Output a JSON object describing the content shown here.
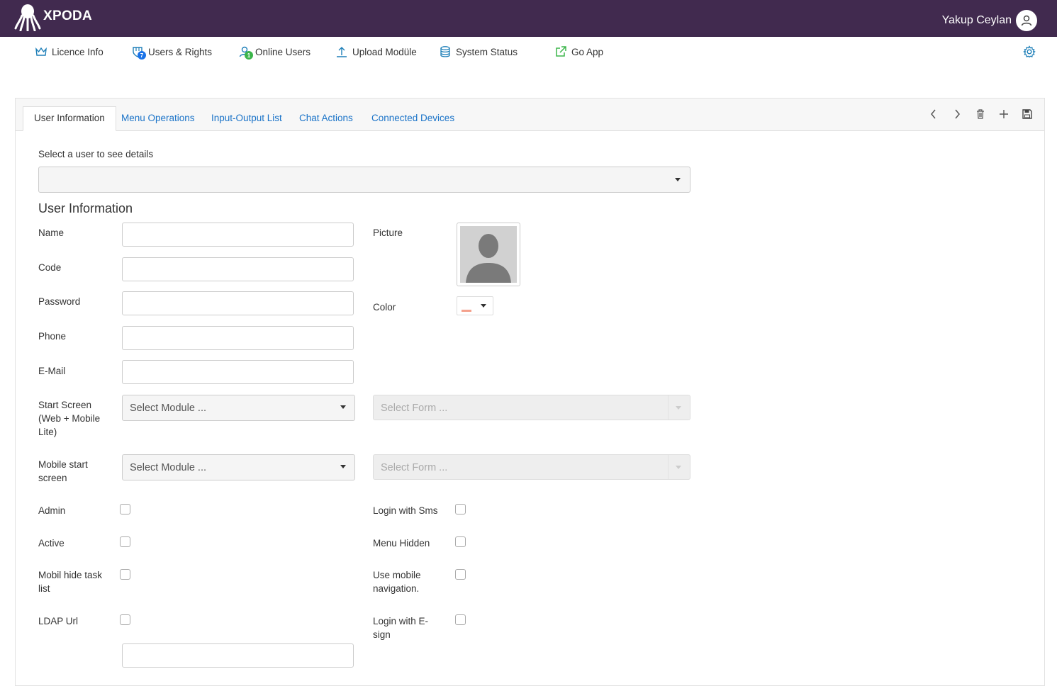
{
  "header": {
    "brand": "XPODA",
    "user_name": "Yakup Ceylan"
  },
  "nav": {
    "items": [
      {
        "label": "Licence Info",
        "icon": "crown-icon"
      },
      {
        "label": "Users & Rights",
        "icon": "users-rights-icon",
        "badge": "7"
      },
      {
        "label": "Online Users",
        "icon": "online-user-icon",
        "badge": "1"
      },
      {
        "label": "Upload Modüle",
        "icon": "upload-icon"
      },
      {
        "label": "System Status",
        "icon": "database-icon"
      },
      {
        "label": "Go App",
        "icon": "external-link-icon"
      }
    ],
    "settings_icon": "gear-icon"
  },
  "tabs": [
    {
      "label": "User Information",
      "active": true
    },
    {
      "label": "Menu Operations"
    },
    {
      "label": "Input-Output List"
    },
    {
      "label": "Chat Actions"
    },
    {
      "label": "Connected Devices"
    }
  ],
  "toolbar": {
    "icons": [
      "chevron-left-icon",
      "chevron-right-icon",
      "trash-icon",
      "plus-icon",
      "save-icon"
    ]
  },
  "user_select": {
    "label": "Select a user to see details",
    "value": ""
  },
  "section_title": "User Information",
  "fields": {
    "name": {
      "label": "Name",
      "value": ""
    },
    "code": {
      "label": "Code",
      "value": ""
    },
    "password": {
      "label": "Password",
      "value": ""
    },
    "phone": {
      "label": "Phone",
      "value": ""
    },
    "email": {
      "label": "E-Mail",
      "value": ""
    },
    "picture": {
      "label": "Picture"
    },
    "color": {
      "label": "Color",
      "value": "#f4a18c"
    },
    "start_screen": {
      "label": "Start Screen (Web + Mobile Lite)",
      "module_placeholder": "Select Module ...",
      "form_placeholder": "Select Form ..."
    },
    "mobile_start": {
      "label": "Mobile start screen",
      "module_placeholder": "Select Module ...",
      "form_placeholder": "Select Form ..."
    },
    "ldap_url": {
      "label": "LDAP Url",
      "value": ""
    }
  },
  "checkboxes": {
    "admin": {
      "label": "Admin",
      "checked": false
    },
    "active": {
      "label": "Active",
      "checked": false
    },
    "mobil_hide_task_list": {
      "label": "Mobil hide task list",
      "checked": false
    },
    "ldap": {
      "label": "LDAP Url",
      "checked": false
    },
    "login_with_sms": {
      "label": "Login with Sms",
      "checked": false
    },
    "menu_hidden": {
      "label": "Menu Hidden",
      "checked": false
    },
    "use_mobile_navigation": {
      "label": "Use mobile navigation.",
      "checked": false
    },
    "login_with_esign": {
      "label": "Login with E-sign",
      "checked": false
    }
  },
  "colors": {
    "header_bg": "#412a4f",
    "accent": "#1a73c8",
    "nav_icon": "#1e7fb8",
    "badge_blue": "#1a73e8",
    "badge_green": "#3bb54a"
  }
}
